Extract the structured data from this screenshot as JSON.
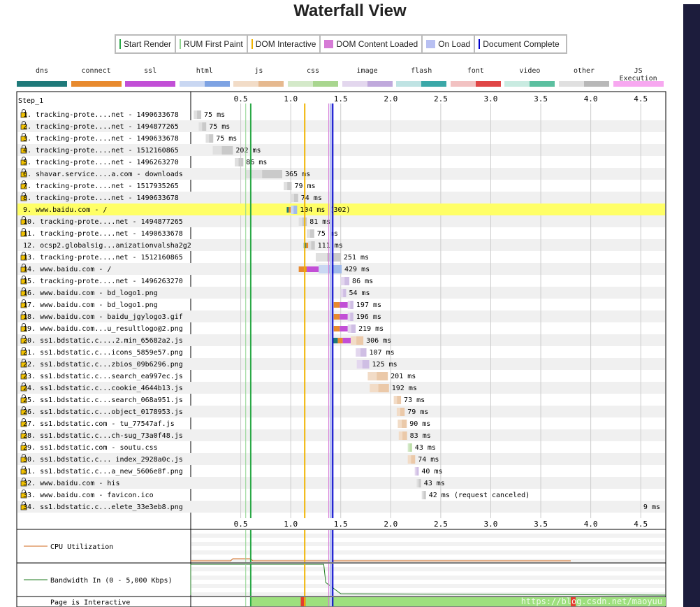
{
  "title": "Waterfall View",
  "legend": [
    {
      "label": "Start Render",
      "color": "#28a745",
      "kind": "line"
    },
    {
      "label": "RUM First Paint",
      "color": "#8fd48f",
      "kind": "line"
    },
    {
      "label": "DOM Interactive",
      "color": "#f0b400",
      "kind": "line"
    },
    {
      "label": "DOM Content Loaded",
      "color": "#d67bd6",
      "kind": "box"
    },
    {
      "label": "On Load",
      "color": "#b8c0f2",
      "kind": "box"
    },
    {
      "label": "Document Complete",
      "color": "#0000cc",
      "kind": "line"
    }
  ],
  "request_types": [
    {
      "label": "dns",
      "colors": [
        "#1f7a7a",
        "#1f7a7a"
      ]
    },
    {
      "label": "connect",
      "colors": [
        "#e88a2e",
        "#e88a2e"
      ]
    },
    {
      "label": "ssl",
      "colors": [
        "#c24fd6",
        "#c24fd6"
      ]
    },
    {
      "label": "html",
      "colors": [
        "#c9d7f2",
        "#7ea3e3"
      ]
    },
    {
      "label": "js",
      "colors": [
        "#f2dcc7",
        "#e6b98f"
      ]
    },
    {
      "label": "css",
      "colors": [
        "#d4e9c9",
        "#a9d68f"
      ]
    },
    {
      "label": "image",
      "colors": [
        "#e3d7ee",
        "#c0a9dc"
      ]
    },
    {
      "label": "flash",
      "colors": [
        "#bfe3e3",
        "#3ba8a8"
      ]
    },
    {
      "label": "font",
      "colors": [
        "#f2c2c2",
        "#e04646"
      ]
    },
    {
      "label": "video",
      "colors": [
        "#c9ebe1",
        "#5cc0a0"
      ]
    },
    {
      "label": "other",
      "colors": [
        "#e0e0e0",
        "#b8b8b8"
      ]
    },
    {
      "label": "JS Execution",
      "colors": [
        "#f7a8f0",
        "#f7a8f0"
      ]
    }
  ],
  "chart_data": {
    "type": "waterfall",
    "step_label": "Step_1",
    "x_ticks": [
      "0.5",
      "1.0",
      "1.5",
      "2.0",
      "2.5",
      "3.0",
      "3.5",
      "4.0",
      "4.5"
    ],
    "xlim": [
      0,
      4.75
    ],
    "markers": {
      "start_render": 0.6,
      "rum_first_paint": 0.55,
      "dom_interactive": 1.14,
      "dom_content_loaded": 1.38,
      "on_load": 1.4,
      "document_complete": 1.42
    },
    "requests": [
      {
        "label": "1. tracking-prote....net - 1490633678",
        "start": 0.03,
        "duration": 0.075,
        "timing": "75 ms",
        "type": "other",
        "lock": true
      },
      {
        "label": "2. tracking-prote....net - 1494877265",
        "start": 0.08,
        "duration": 0.075,
        "timing": "75 ms",
        "type": "other",
        "lock": true
      },
      {
        "label": "3. tracking-prote....net - 1490633678",
        "start": 0.15,
        "duration": 0.075,
        "timing": "75 ms",
        "type": "other",
        "lock": true
      },
      {
        "label": "4. tracking-prote....net - 1512160865",
        "start": 0.22,
        "duration": 0.202,
        "timing": "202 ms",
        "type": "other",
        "lock": true
      },
      {
        "label": "5. tracking-prote....net - 1496263270",
        "start": 0.44,
        "duration": 0.086,
        "timing": "86 ms",
        "type": "other",
        "lock": true
      },
      {
        "label": "6. shavar.service....a.com - downloads",
        "start": 0.55,
        "duration": 0.365,
        "timing": "365 ms",
        "type": "other",
        "lock": true
      },
      {
        "label": "7. tracking-prote....net - 1517935265",
        "start": 0.93,
        "duration": 0.079,
        "timing": "79 ms",
        "type": "other",
        "lock": true
      },
      {
        "label": "8. tracking-prote....net - 1490633678",
        "start": 1.0,
        "duration": 0.074,
        "timing": "74 ms",
        "type": "other",
        "lock": true
      },
      {
        "label": "9. www.baidu.com - /",
        "start": 0.96,
        "duration": 0.104,
        "timing": "104 ms (302)",
        "type": "html",
        "lock": false,
        "highlight": true,
        "phases": [
          {
            "t": "dns",
            "d": 0.02
          },
          {
            "t": "connect",
            "d": 0.02
          }
        ]
      },
      {
        "label": "10. tracking-prote....net - 1494877265",
        "start": 1.08,
        "duration": 0.081,
        "timing": "81 ms",
        "type": "other",
        "lock": true
      },
      {
        "label": "11. tracking-prote....net - 1490633678",
        "start": 1.16,
        "duration": 0.075,
        "timing": "75 ms",
        "type": "other",
        "lock": true
      },
      {
        "label": "12. ocsp2.globalsig...anizationvalsha2g2",
        "start": 1.13,
        "duration": 0.111,
        "timing": "111 ms",
        "type": "other",
        "lock": false,
        "phases": [
          {
            "t": "dns",
            "d": 0.025
          },
          {
            "t": "connect",
            "d": 0.02
          }
        ]
      },
      {
        "label": "13. tracking-prote....net - 1512160865",
        "start": 1.25,
        "duration": 0.251,
        "timing": "251 ms",
        "type": "other",
        "lock": true
      },
      {
        "label": "14. www.baidu.com - /",
        "start": 1.08,
        "duration": 0.429,
        "timing": "429 ms",
        "type": "html",
        "lock": true,
        "phases": [
          {
            "t": "connect",
            "d": 0.08
          },
          {
            "t": "ssl",
            "d": 0.12
          }
        ]
      },
      {
        "label": "15. tracking-prote....net - 1496263270",
        "start": 1.5,
        "duration": 0.086,
        "timing": "86 ms",
        "type": "image",
        "lock": true
      },
      {
        "label": "16. www.baidu.com - bd_logo1.png",
        "start": 1.5,
        "duration": 0.054,
        "timing": "54 ms",
        "type": "image",
        "lock": true
      },
      {
        "label": "17. www.baidu.com - bd_logo1.png",
        "start": 1.43,
        "duration": 0.197,
        "timing": "197 ms",
        "type": "image",
        "lock": true,
        "phases": [
          {
            "t": "connect",
            "d": 0.06
          },
          {
            "t": "ssl",
            "d": 0.08
          }
        ]
      },
      {
        "label": "18. www.baidu.com - baidu_jgylogo3.gif",
        "start": 1.43,
        "duration": 0.196,
        "timing": "196 ms",
        "type": "image",
        "lock": true,
        "phases": [
          {
            "t": "connect",
            "d": 0.06
          },
          {
            "t": "ssl",
            "d": 0.08
          }
        ]
      },
      {
        "label": "19. www.baidu.com...u_resultlogo@2.png",
        "start": 1.43,
        "duration": 0.219,
        "timing": "219 ms",
        "type": "image",
        "lock": true,
        "phases": [
          {
            "t": "connect",
            "d": 0.06
          },
          {
            "t": "ssl",
            "d": 0.08
          }
        ]
      },
      {
        "label": "20. ss1.bdstatic.c....2.min_65682a2.js",
        "start": 1.42,
        "duration": 0.306,
        "timing": "306 ms",
        "type": "js",
        "lock": true,
        "phases": [
          {
            "t": "dns",
            "d": 0.05
          },
          {
            "t": "connect",
            "d": 0.05
          },
          {
            "t": "ssl",
            "d": 0.08
          }
        ]
      },
      {
        "label": "21. ss1.bdstatic.c...icons_5859e57.png",
        "start": 1.65,
        "duration": 0.107,
        "timing": "107 ms",
        "type": "image",
        "lock": true
      },
      {
        "label": "22. ss1.bdstatic.c...zbios_09b6296.png",
        "start": 1.66,
        "duration": 0.125,
        "timing": "125 ms",
        "type": "image",
        "lock": true
      },
      {
        "label": "23. ss1.bdstatic.c...search_ea997ec.js",
        "start": 1.77,
        "duration": 0.201,
        "timing": "201 ms",
        "type": "js",
        "lock": true
      },
      {
        "label": "24. ss1.bdstatic.c...cookie_4644b13.js",
        "start": 1.79,
        "duration": 0.192,
        "timing": "192 ms",
        "type": "js",
        "lock": true
      },
      {
        "label": "25. ss1.bdstatic.c...search_068a951.js",
        "start": 2.03,
        "duration": 0.073,
        "timing": "73 ms",
        "type": "js",
        "lock": true
      },
      {
        "label": "26. ss1.bdstatic.c...object_0178953.js",
        "start": 2.06,
        "duration": 0.079,
        "timing": "79 ms",
        "type": "js",
        "lock": true
      },
      {
        "label": "27. ss1.bdstatic.com - tu_77547af.js",
        "start": 2.07,
        "duration": 0.09,
        "timing": "90 ms",
        "type": "js",
        "lock": true
      },
      {
        "label": "28. ss1.bdstatic.c...ch-sug_73a0f48.js",
        "start": 2.08,
        "duration": 0.083,
        "timing": "83 ms",
        "type": "js",
        "lock": true
      },
      {
        "label": "29. ss1.bdstatic.com - soutu.css",
        "start": 2.17,
        "duration": 0.043,
        "timing": "43 ms",
        "type": "css",
        "lock": true
      },
      {
        "label": "30. ss1.bdstatic.c... index_2928a0c.js",
        "start": 2.17,
        "duration": 0.074,
        "timing": "74 ms",
        "type": "js",
        "lock": true
      },
      {
        "label": "31. ss1.bdstatic.c...a_new_5606e8f.png",
        "start": 2.24,
        "duration": 0.04,
        "timing": "40 ms",
        "type": "image",
        "lock": true
      },
      {
        "label": "32. www.baidu.com - his",
        "start": 2.26,
        "duration": 0.043,
        "timing": "43 ms",
        "type": "other",
        "lock": true
      },
      {
        "label": "33. www.baidu.com - favicon.ico",
        "start": 2.31,
        "duration": 0.042,
        "timing": "42 ms (request canceled)",
        "type": "other",
        "lock": true
      },
      {
        "label": "34. ss1.bdstatic.c...elete_33e3eb8.png",
        "start": 4.95,
        "duration": 0.009,
        "timing": "9 ms",
        "type": "image",
        "lock": true
      }
    ],
    "bottom_panels": [
      {
        "label": "CPU Utilization"
      },
      {
        "label": "Bandwidth In (0 - 5,000 Kbps)"
      },
      {
        "label": "Page is Interactive"
      }
    ],
    "page_interactive": {
      "start": 0.6,
      "end": 4.75,
      "red_at": [
        1.1,
        3.8
      ]
    },
    "watermark": "https://blog.csdn.net/maoyuu"
  }
}
